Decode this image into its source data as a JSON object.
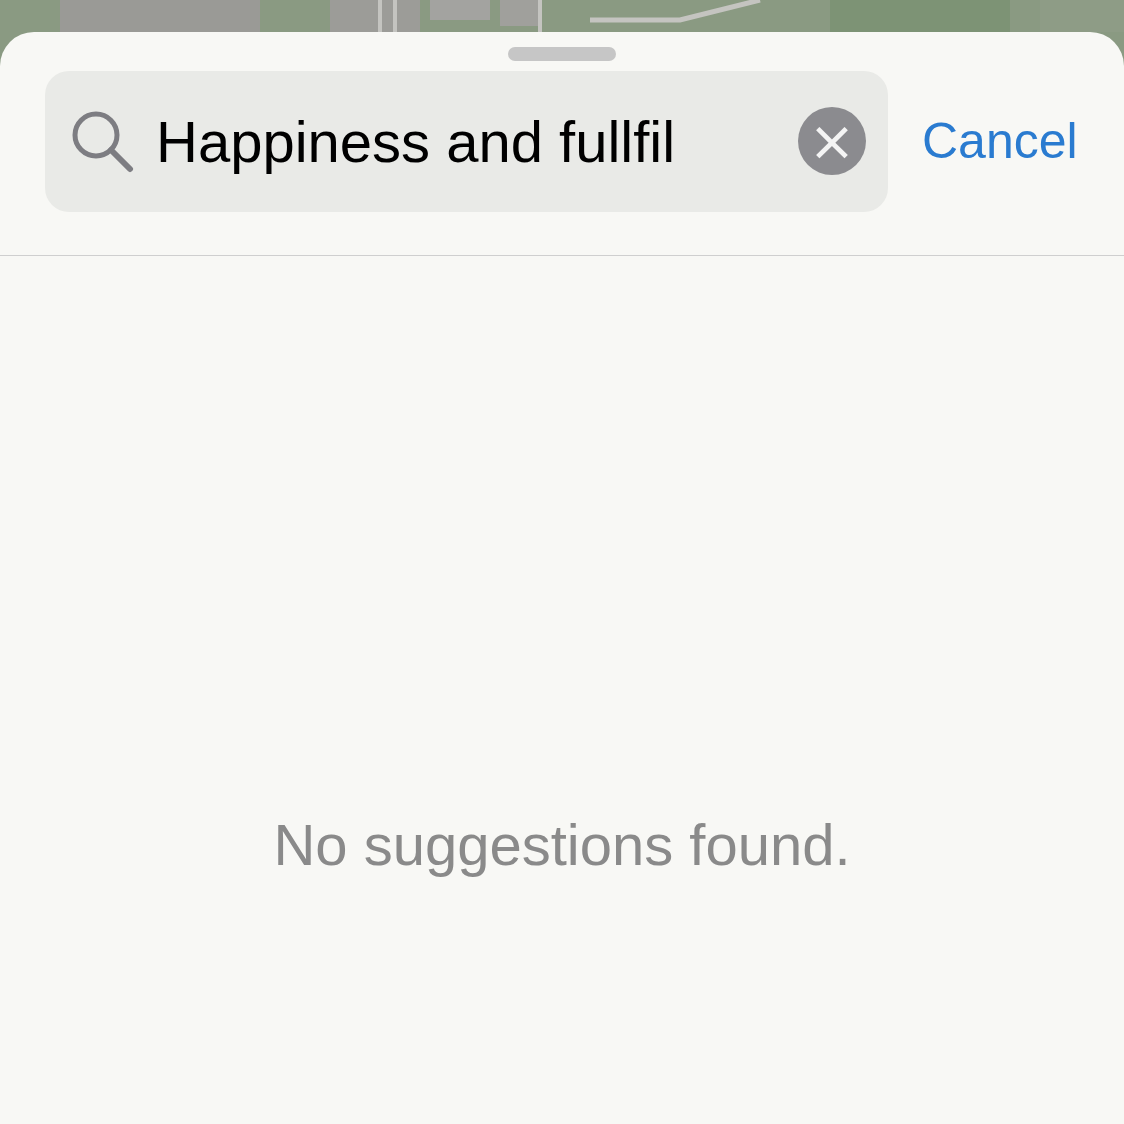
{
  "search": {
    "value": "Happiness and fullfil",
    "clear_button": "×"
  },
  "cancel": "Cancel",
  "message": "No suggestions found."
}
